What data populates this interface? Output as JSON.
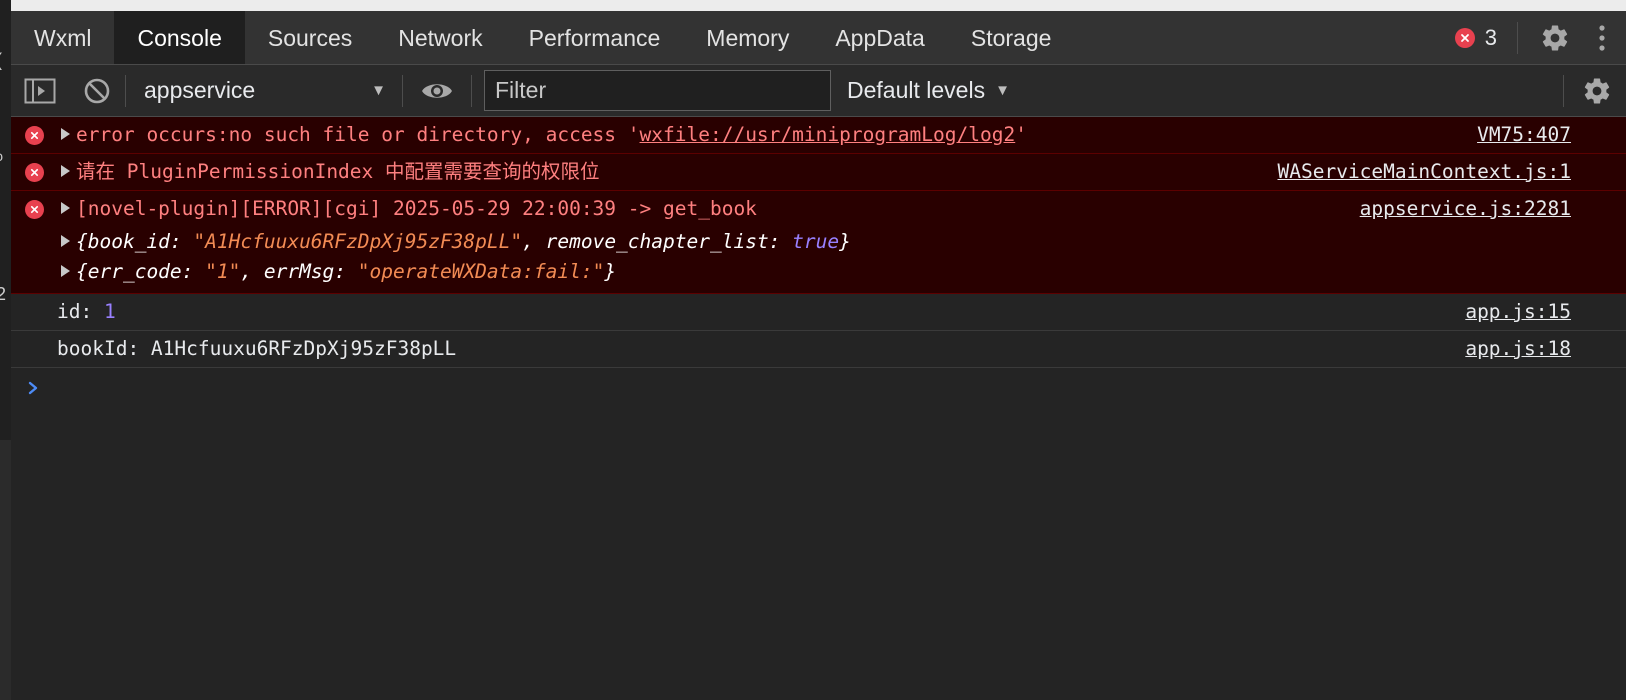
{
  "tabs": [
    "Wxml",
    "Console",
    "Sources",
    "Network",
    "Performance",
    "Memory",
    "AppData",
    "Storage"
  ],
  "error_count": "3",
  "toolbar": {
    "context": "appservice",
    "filter_placeholder": "Filter",
    "levels": "Default levels"
  },
  "messages": {
    "m1": {
      "prefix": "error occurs:no such file or directory, access '",
      "link": "wxfile://usr/miniprogramLog/log2",
      "suffix": "'",
      "source": "VM75:407"
    },
    "m2": {
      "text": "请在 PluginPermissionIndex 中配置需要查询的权限位",
      "source": "WAServiceMainContext.js:1"
    },
    "m3": {
      "text": "[novel-plugin][ERROR][cgi] 2025-05-29 22:00:39 -> get_book",
      "source": "appservice.js:2281",
      "obj1": {
        "open": "{book_id: ",
        "book_id": "\"A1Hcfuuxu6RFzDpXj95zF38pLL\"",
        "sep": ", remove_chapter_list: ",
        "remove_chapter_list": "true",
        "close": "}"
      },
      "obj2": {
        "open": "{err_code: ",
        "err_code": "\"1\"",
        "sep": ", errMsg: ",
        "errMsg": "\"operateWXData:fail:\"",
        "close": "}"
      }
    },
    "m4": {
      "label": "id: ",
      "value": "1",
      "source": "app.js:15"
    },
    "m5": {
      "text": "bookId: A1Hcfuuxu6RFzDpXj95zF38pLL",
      "source": "app.js:18"
    }
  },
  "colors": {
    "error_bg": "#290000",
    "error_text": "#ff8080",
    "string": "#f28b54",
    "keyword": "#9980ff",
    "accent": "#4d8bf5"
  }
}
